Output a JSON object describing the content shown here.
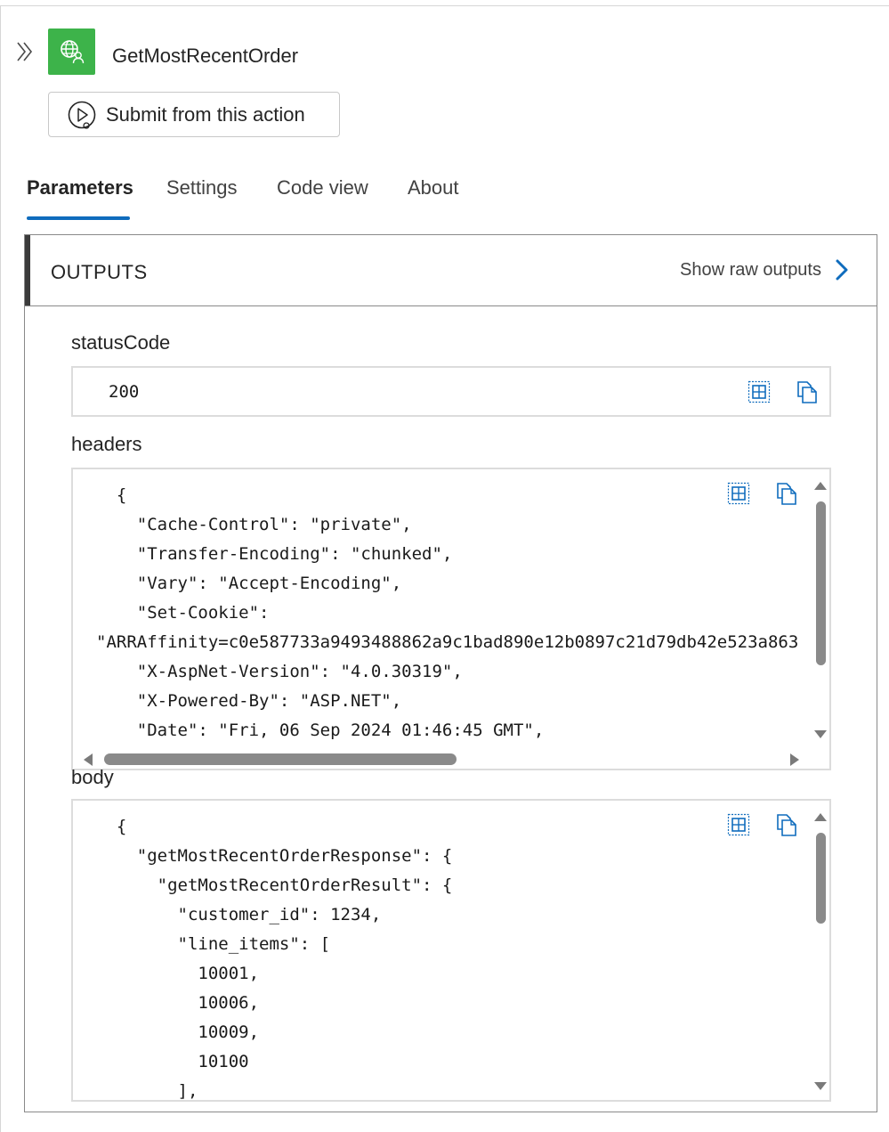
{
  "action": {
    "title": "GetMostRecentOrder",
    "icon": "globe-person-icon",
    "icon_color": "#3db34a",
    "collapse_icon": "double-chevron-right-icon"
  },
  "submit_button": {
    "label": "Submit from this action",
    "icon": "play-circle-icon"
  },
  "tabs": [
    {
      "label": "Parameters",
      "active": true
    },
    {
      "label": "Settings",
      "active": false
    },
    {
      "label": "Code view",
      "active": false
    },
    {
      "label": "About",
      "active": false
    }
  ],
  "accent_color": "#0f6cbd",
  "outputs": {
    "title": "OUTPUTS",
    "raw_outputs_label": "Show raw outputs",
    "fields": {
      "status_code": {
        "label": "statusCode",
        "value": "200"
      },
      "headers": {
        "label": "headers",
        "lines": [
          "  {",
          "    \"Cache-Control\": \"private\",",
          "    \"Transfer-Encoding\": \"chunked\",",
          "    \"Vary\": \"Accept-Encoding\",",
          "    \"Set-Cookie\":",
          "\"ARRAffinity=c0e587733a9493488862a9c1bad890e12b0897c21d79db42e523a863",
          "    \"X-AspNet-Version\": \"4.0.30319\",",
          "    \"X-Powered-By\": \"ASP.NET\",",
          "    \"Date\": \"Fri, 06 Sep 2024 01:46:45 GMT\","
        ]
      },
      "body": {
        "label": "body",
        "lines": [
          "  {",
          "    \"getMostRecentOrderResponse\": {",
          "      \"getMostRecentOrderResult\": {",
          "        \"customer_id\": 1234,",
          "        \"line_items\": [",
          "          10001,",
          "          10006,",
          "          10009,",
          "          10100",
          "        ],"
        ]
      }
    },
    "tool_icons": [
      "table-view-icon",
      "copy-icon"
    ]
  }
}
